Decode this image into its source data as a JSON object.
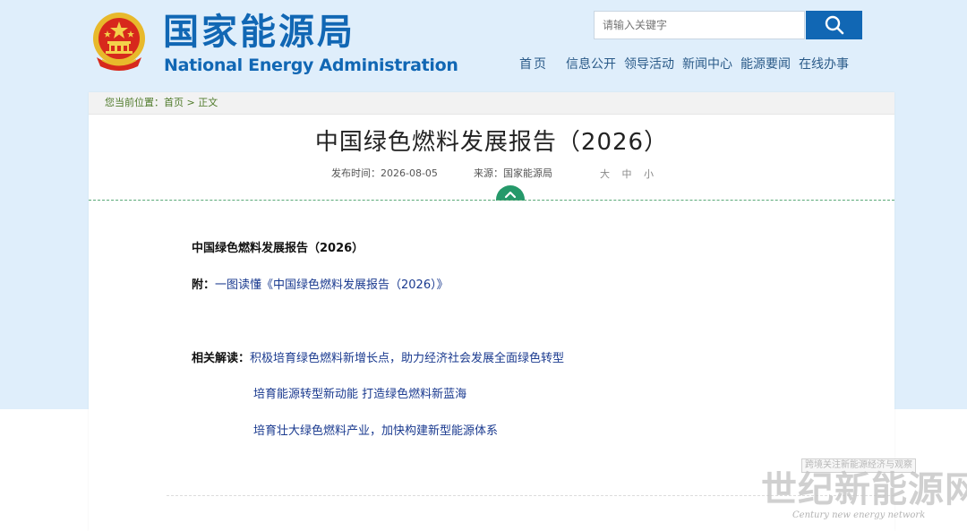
{
  "header": {
    "title": "国家能源局",
    "subtitle": "National Energy Administration",
    "search_placeholder": "请输入关键字",
    "nav": [
      "首页",
      "信息公开",
      "领导活动",
      "新闻中心",
      "能源要闻",
      "在线办事"
    ]
  },
  "breadcrumb": {
    "prefix": "您当前位置：",
    "home": "首页",
    "sep": " > ",
    "current": "正文"
  },
  "article": {
    "title": "中国绿色燃料发展报告（2026）",
    "publish_label": "发布时间：",
    "publish_date": "2026-08-05",
    "source_label": "来源：",
    "source": "国家能源局",
    "font_sizes": [
      "大",
      "中",
      "小"
    ],
    "body_title": "中国绿色燃料发展报告（2026）",
    "attachment_label": "附：",
    "attachment_link": "一图读懂《中国绿色燃料发展报告（2026）》",
    "related_label": "相关解读：",
    "related_links": [
      "积极培育绿色燃料新增长点，助力经济社会发展全面绿色转型",
      "培育能源转型新动能 打造绿色燃料新蓝海",
      "培育壮大绿色燃料产业，加快构建新型能源体系"
    ]
  },
  "watermark": {
    "tag": "跨境关注新能源经济与观察",
    "name": "世纪新能源网",
    "english": "Century new energy network"
  },
  "colors": {
    "brand_blue": "#1167b4",
    "page_bg": "#dfeefb",
    "accent_green": "#25996a"
  }
}
